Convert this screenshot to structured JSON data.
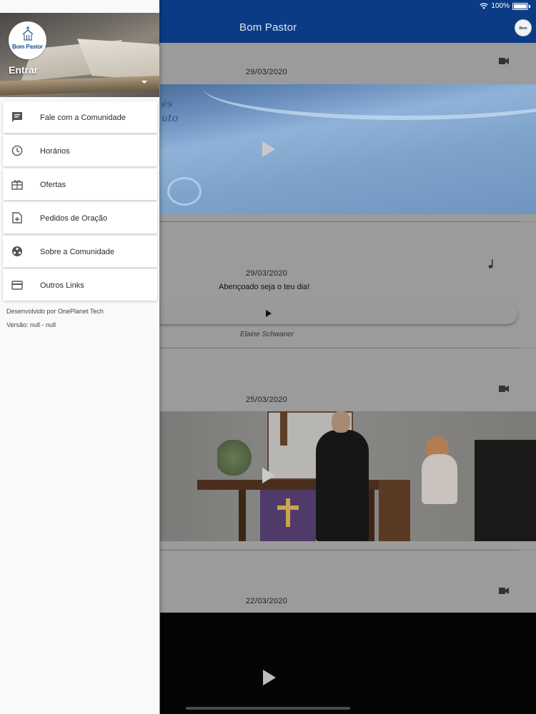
{
  "status_bar": {
    "battery": "100%"
  },
  "app_bar": {
    "title": "Bom Pastor",
    "avatar_text": "Bom Pastor"
  },
  "feed": {
    "posts": [
      {
        "date": "29/03/2020",
        "type": "video"
      },
      {
        "date": "29/03/2020",
        "type": "audio",
        "title": "Abençoado seja o teu dia!",
        "author": "Elaine Schwaner"
      },
      {
        "date": "25/03/2020",
        "type": "video"
      },
      {
        "date": "22/03/2020",
        "type": "video"
      }
    ]
  },
  "drawer": {
    "logo_text": "Bom Pastor",
    "login_label": "Entrar",
    "menu": [
      {
        "label": "Fale com a Comunidade",
        "icon": "chat-icon"
      },
      {
        "label": "Horários",
        "icon": "clock-icon"
      },
      {
        "label": "Ofertas",
        "icon": "gift-icon"
      },
      {
        "label": "Pedidos de Oração",
        "icon": "prayer-request-icon"
      },
      {
        "label": "Sobre a Comunidade",
        "icon": "community-icon"
      },
      {
        "label": "Outros Links",
        "icon": "card-icon"
      }
    ],
    "developer": "Desenvolvido por OnePlanet Tech",
    "version": "Versão: null - null"
  }
}
